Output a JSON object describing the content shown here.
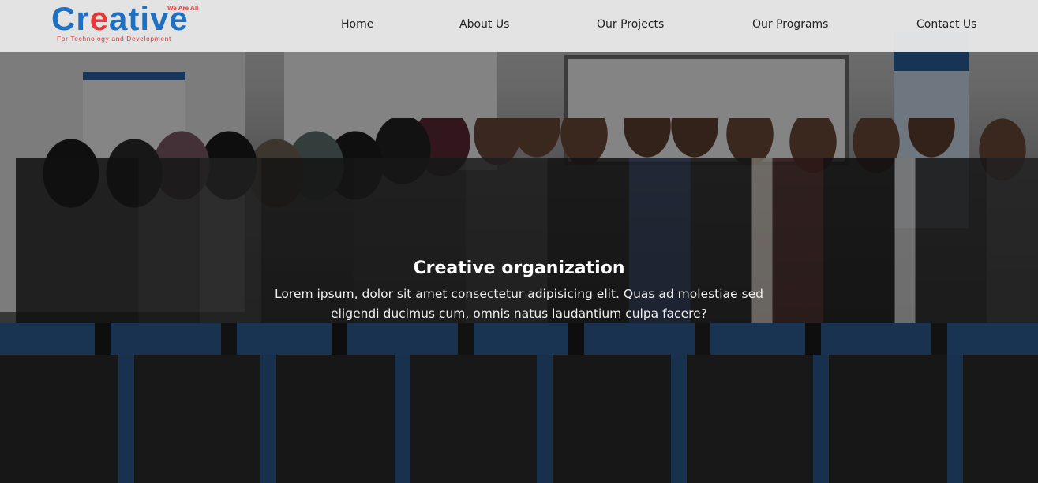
{
  "logo": {
    "word_start": "Cr",
    "word_gear": "e",
    "word_end": "ative",
    "tagline": "We Are All",
    "subtitle": "For Technology and Development"
  },
  "nav": {
    "items": [
      {
        "label": "Home"
      },
      {
        "label": "About Us"
      },
      {
        "label": "Our Projects"
      },
      {
        "label": "Our Programs"
      },
      {
        "label": "Contact Us"
      }
    ]
  },
  "hero": {
    "title": "Creative organization",
    "text": "Lorem ipsum, dolor sit amet consectetur adipisicing elit. Quas ad molestiae sed eligendi ducimus cum, omnis natus laudantium culpa facere?"
  },
  "colors": {
    "brand_blue": "#1f6fc2",
    "brand_red": "#e23a3a",
    "header_bg": "#e8e8e8"
  }
}
